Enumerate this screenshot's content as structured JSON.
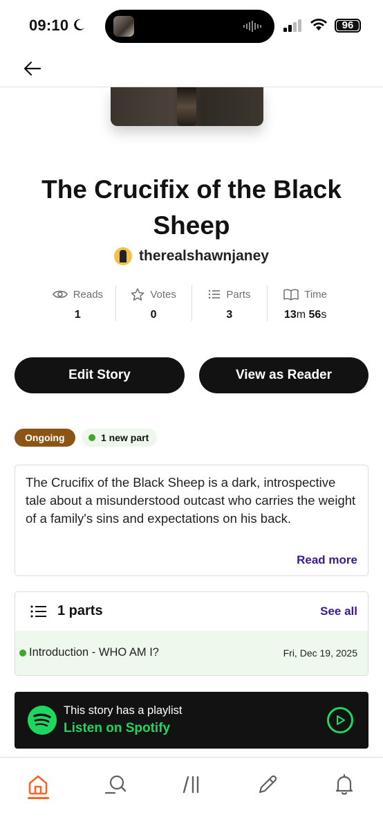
{
  "status_bar": {
    "time": "09:10",
    "battery": "96"
  },
  "nav": {
    "back_icon": "arrow-left-icon"
  },
  "story": {
    "title": "The Crucifix of the Black Sheep",
    "author": "therealshawnjaney"
  },
  "stats": {
    "reads": {
      "label": "Reads",
      "value": "1",
      "icon": "eye-icon"
    },
    "votes": {
      "label": "Votes",
      "value": "0",
      "icon": "star-icon"
    },
    "parts": {
      "label": "Parts",
      "value": "3",
      "icon": "list-icon"
    },
    "time": {
      "label": "Time",
      "minutes": "13",
      "minutes_unit": "m",
      "seconds": "56",
      "seconds_unit": "s",
      "icon": "book-icon"
    }
  },
  "actions": {
    "edit_label": "Edit Story",
    "view_label": "View as Reader"
  },
  "tags": {
    "status": "Ongoing",
    "new_parts": "1 new part"
  },
  "description": {
    "text": "The Crucifix of the Black Sheep is a dark, introspective tale about a misunderstood outcast who carries the weight of a family's sins and expectations on his back.",
    "read_more": "Read more"
  },
  "parts_section": {
    "count_label": "1 parts",
    "see_all": "See all",
    "items": [
      {
        "title": "Introduction - WHO AM I?",
        "date": "Fri, Dec 19, 2025"
      }
    ]
  },
  "spotify": {
    "label": "This story has a playlist",
    "link": "Listen on Spotify"
  },
  "tabbar": {
    "items": [
      "home-icon",
      "search-icon",
      "library-icon",
      "write-icon",
      "notifications-icon"
    ],
    "active_color": "#ff6122"
  },
  "colors": {
    "ongoing": "#8b5516",
    "link": "#3a1a8c",
    "new_dot": "#3fa82a",
    "spotify": "#1ed760"
  }
}
